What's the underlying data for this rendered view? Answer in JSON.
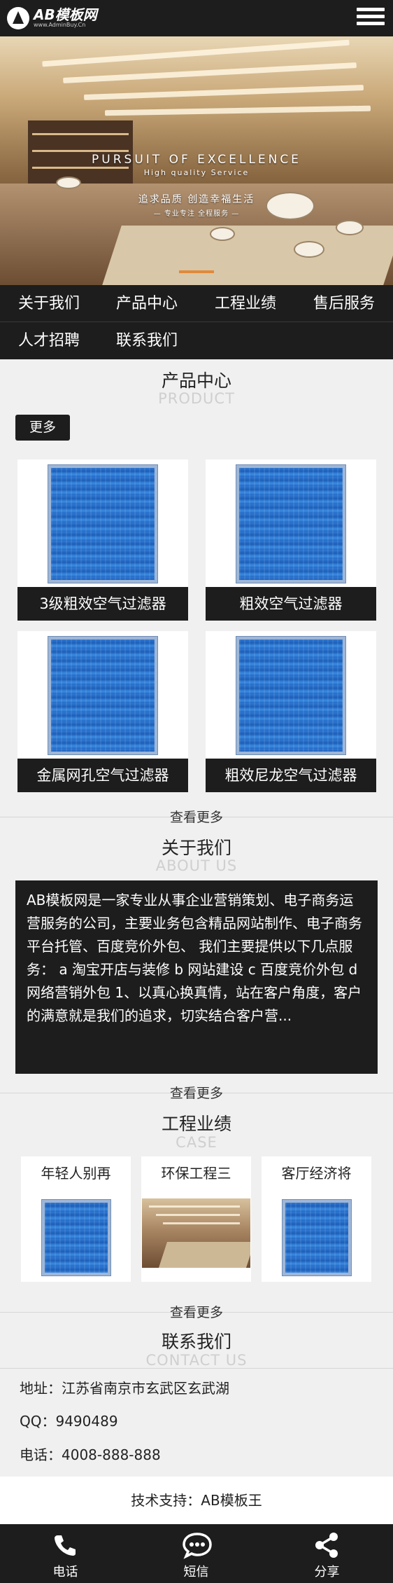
{
  "header": {
    "logo_title": "AB模板网",
    "logo_sub": "www.AdminBuy.Cn",
    "menu_icon": "hamburger-icon"
  },
  "banner": {
    "line1": "PURSUIT OF EXCELLENCE",
    "line2": "High quality Service",
    "line3": "追求品质 创造幸福生活",
    "line4": "— 专业专注 全程服务 —"
  },
  "nav": {
    "items": [
      "关于我们",
      "产品中心",
      "工程业绩",
      "售后服务",
      "人才招聘",
      "联系我们"
    ]
  },
  "products": {
    "title": "产品中心",
    "subtitle": "PRODUCT",
    "more_button": "更多",
    "items": [
      {
        "label": "3级粗效空气过滤器"
      },
      {
        "label": "粗效空气过滤器"
      },
      {
        "label": "金属网孔空气过滤器"
      },
      {
        "label": "粗效尼龙空气过滤器"
      }
    ],
    "view_more": "查看更多"
  },
  "about": {
    "title": "关于我们",
    "subtitle": "ABOUT US",
    "text": "AB模板网是一家专业从事企业营销策划、电子商务运营服务的公司，主要业务包含精品网站制作、电子商务平台托管、百度竞价外包、 我们主要提供以下几点服务： a 淘宝开店与装修 b 网站建设 c 百度竞价外包 d 网络营销外包 1、以真心换真情，站在客户角度，客户的满意就是我们的追求，切实结合客户营...",
    "view_more": "查看更多"
  },
  "cases": {
    "title": "工程业绩",
    "subtitle": "CASE",
    "items": [
      {
        "title": "年轻人别再"
      },
      {
        "title": "环保工程三"
      },
      {
        "title": "客厅经济将"
      }
    ],
    "view_more": "查看更多"
  },
  "contact": {
    "title": "联系我们",
    "subtitle": "CONTACT US",
    "address": "地址：江苏省南京市玄武区玄武湖",
    "qq": "QQ：9490489",
    "phone": "电话：4008-888-888"
  },
  "tech_support": "技术支持：AB模板王",
  "footer": {
    "call": "电话",
    "sms": "短信",
    "share": "分享"
  },
  "colors": {
    "dark": "#1d1d1d",
    "background": "#f0f0f0",
    "accent": "#e08a3b",
    "filter_blue": "#2f78d2"
  }
}
